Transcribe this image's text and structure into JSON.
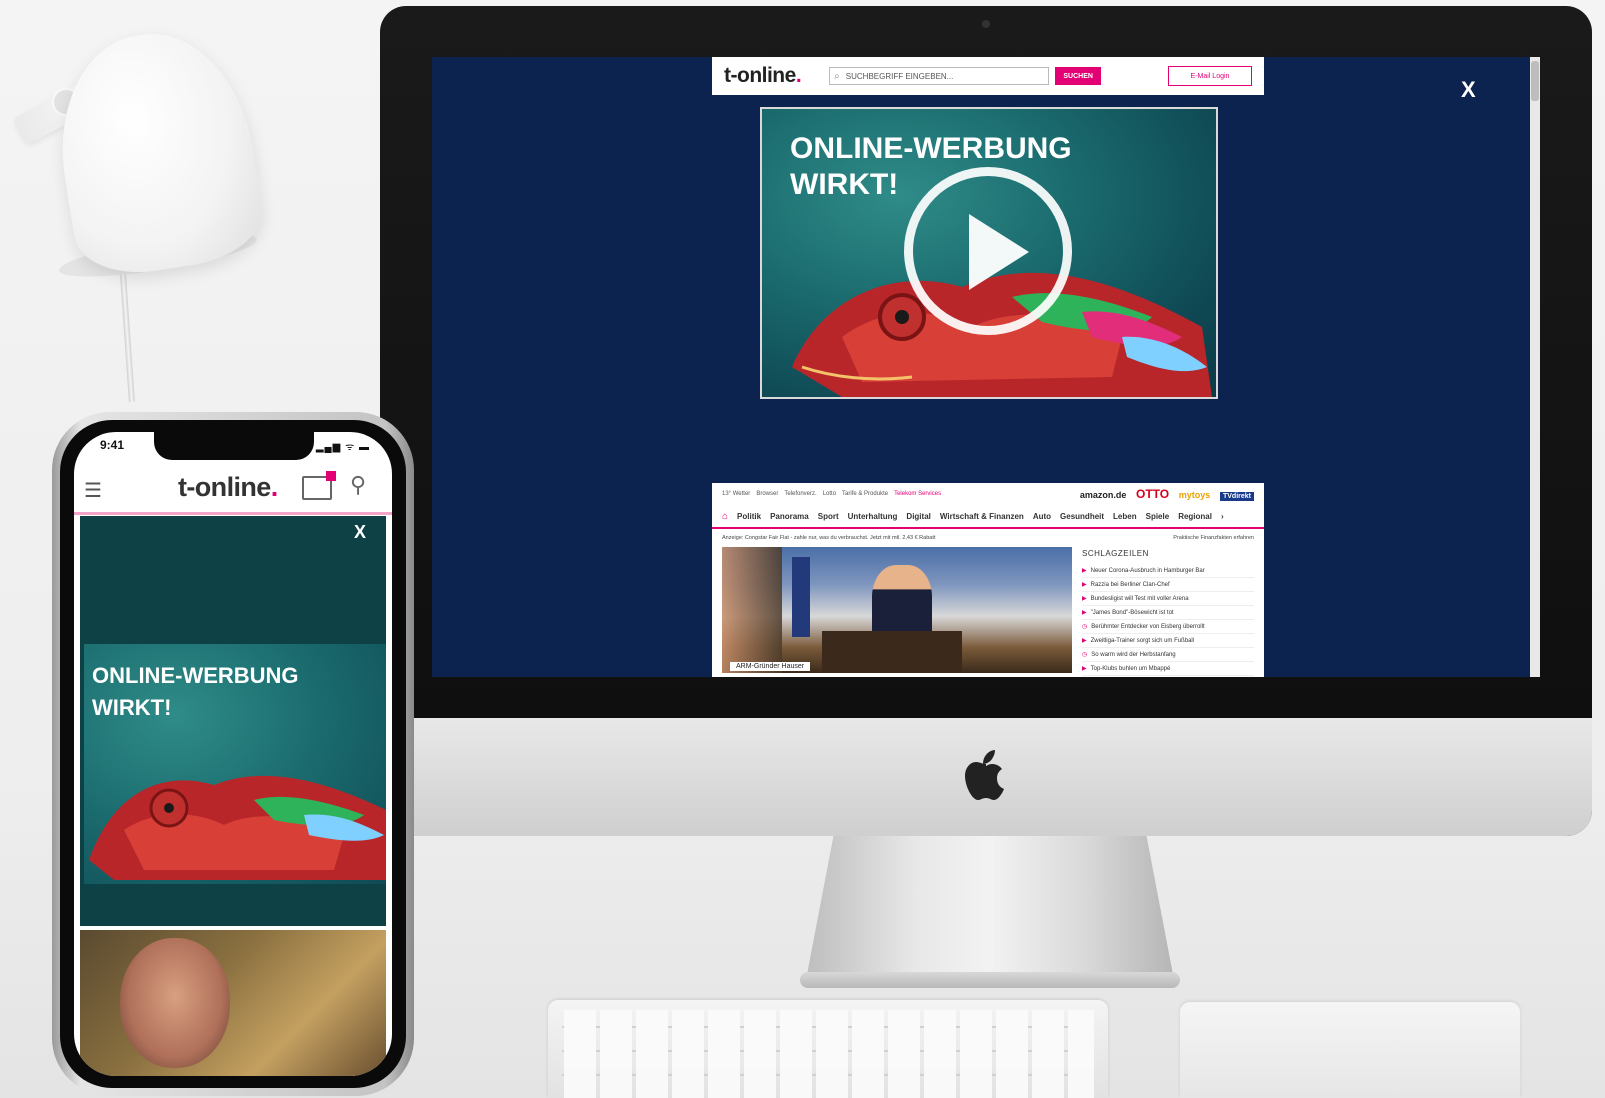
{
  "desktop": {
    "site_logo": "t-online",
    "search_placeholder": "SUCHBEGRIFF EINGEBEN...",
    "search_button": "SUCHEN",
    "login_button": "E-Mail Login",
    "close_label": "X",
    "ad_headline_1": "ONLINE-WERBUNG",
    "ad_headline_2": "WIRKT!",
    "utility_links": [
      "13° Wetter",
      "Browser",
      "Telefonverz.",
      "Lotto",
      "Tarife & Produkte"
    ],
    "utility_highlight": "Telekom Services",
    "brands": [
      "amazon.de",
      "OTTO",
      "mytoys",
      "TVdirekt"
    ],
    "nav_items": [
      "Politik",
      "Panorama",
      "Sport",
      "Unterhaltung",
      "Digital",
      "Wirtschaft & Finanzen",
      "Auto",
      "Gesundheit",
      "Leben",
      "Spiele",
      "Regional"
    ],
    "ad_line": "Anzeige: Congstar Fair Flat - zahle nur, was du verbrauchst. Jetzt mit mtl. 2,43 € Rabatt",
    "ad_line_right": "Praktische Finanzfakten erfahren",
    "photo_caption": "ARM-Gründer Hauser",
    "headlines_title": "SCHLAGZEILEN",
    "headlines": [
      "Neuer Corona-Ausbruch in Hamburger Bar",
      "Razzia bei Berliner Clan-Chef",
      "Bundesligist will Test mit voller Arena",
      "\"James Bond\"-Bösewicht ist tot",
      "Berühmter Entdecker von Eisberg überrollt",
      "Zweitliga-Trainer sorgt sich um Fußball",
      "So warm wird der Herbstanfang",
      "Top-Klubs buhlen um Mbappé"
    ]
  },
  "mobile": {
    "time": "9:41",
    "status_icons": "▂▄▆ ᯤ ▬",
    "site_logo": "t-online",
    "close_label": "X",
    "ad_headline_1": "ONLINE-WERBUNG",
    "ad_headline_2": "WIRKT!"
  }
}
